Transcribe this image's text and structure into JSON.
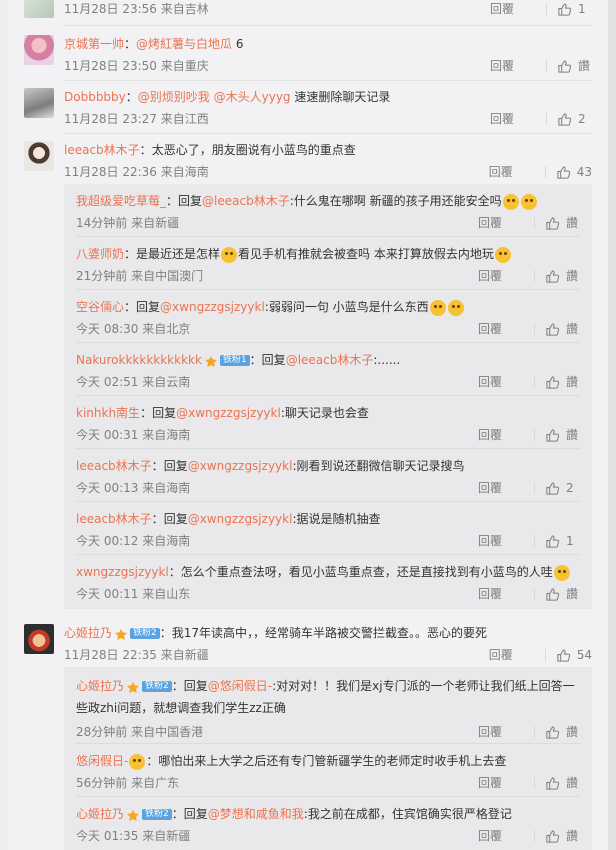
{
  "ui": {
    "reply_label": "回覆"
  },
  "comments": [
    {
      "user": "",
      "text": "",
      "time": "11月28日 23:56 来自吉林",
      "likes": "1"
    },
    {
      "user": "京城第一帅",
      "mention": "@烤紅薯与白地瓜",
      "text": "6",
      "time": "11月28日 23:50 来自重庆",
      "likes": "讚"
    },
    {
      "user": "Dobbbbby",
      "mention": "@别烦别吵我 @木头人yyyg",
      "text": "速速删除聊天记录",
      "time": "11月28日 23:27 来自江西",
      "likes": "2"
    },
    {
      "user": "leeacb林木子",
      "text": "太恶心了，朋友圈说有小蓝鸟的重点查",
      "time": "11月28日 22:36 来自海南",
      "likes": "43",
      "replies": [
        {
          "user": "我超级爱吃草莓_",
          "prefix": "回复",
          "mention": "@leeacb林木子",
          "text": ":什么鬼在哪啊 新疆的孩子用还能安全吗",
          "time": "14分钟前 来自新疆",
          "likes": "讚"
        },
        {
          "user": "八婆师奶",
          "text": "是最近还是怎样",
          "text2": "看见手机有推就会被查吗 本来打算放假去内地玩",
          "time": "21分钟前 来自中国澳门",
          "likes": "讚"
        },
        {
          "user": "空谷倆心",
          "prefix": "回复",
          "mention": "@xwngzzgsjzyykl",
          "text": ":弱弱问一句 小蓝鸟是什么东西",
          "time": "今天 08:30 来自北京",
          "likes": "讚"
        },
        {
          "user": "Nakurokkkkkkkkkkkk",
          "badge": "铁粉1",
          "prefix": "回复",
          "mention": "@leeacb林木子",
          "text": ":......",
          "time": "今天 02:51 来自云南",
          "likes": "讚"
        },
        {
          "user": "kinhkh南生",
          "prefix": "回复",
          "mention": "@xwngzzgsjzyykl",
          "text": ":聊天记录也会查",
          "time": "今天 00:31 来自海南",
          "likes": "讚"
        },
        {
          "user": "leeacb林木子",
          "prefix": "回复",
          "mention": "@xwngzzgsjzyykl",
          "text": ":刚看到说还翻微信聊天记录搜鸟",
          "time": "今天 00:13 来自海南",
          "likes": "2"
        },
        {
          "user": "leeacb林木子",
          "prefix": "回复",
          "mention": "@xwngzzgsjzyykl",
          "text": ":据说是随机抽查",
          "time": "今天 00:12 来自海南",
          "likes": "1"
        },
        {
          "user": "xwngzzgsjzyykl",
          "text": "怎么个重点查法呀，看见小蓝鸟重点查，还是直接找到有小蓝鸟的人哇",
          "time": "今天 00:11 来自山东",
          "likes": "讚"
        }
      ]
    },
    {
      "user": "心姬拉乃",
      "badge": "铁粉2",
      "text": "我17年读高中，，经常骑车半路被交警拦截查。。恶心的要死",
      "time": "11月28日 22:35 来自新疆",
      "likes": "54",
      "replies": [
        {
          "user": "心姬拉乃",
          "badge": "铁粉2",
          "prefix": "回复",
          "mention": "@悠闲假日-",
          "text": ":对对对！！我们是xj专门派的一个老师让我们纸上回答一些政zhi问题，就想调查我们学生zz正确",
          "time": "28分钟前 来自中国香港",
          "likes": "讚"
        },
        {
          "user": "悠闲假日-",
          "text": "哪怕出来上大学之后还有专门管新疆学生的老师定时收手机上去查",
          "time": "56分钟前 来自广东",
          "likes": "讚"
        },
        {
          "user": "心姬拉乃",
          "badge": "铁粉2",
          "prefix": "回复",
          "mention": "@梦想和咸鱼和我",
          "text": ":我之前在成都，住宾馆确实很严格登记",
          "time": "今天 01:35 来自新疆",
          "likes": "讚"
        }
      ]
    }
  ]
}
